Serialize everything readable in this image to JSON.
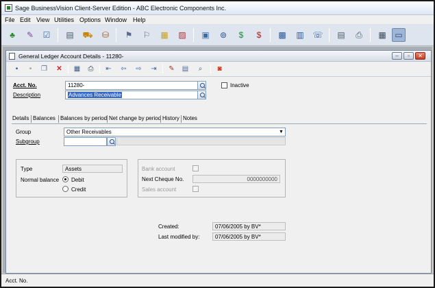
{
  "app": {
    "title": "Sage BusinessVision Client-Server Edition - ABC Electronic Components Inc."
  },
  "menu": [
    "File",
    "Edit",
    "View",
    "Utilities",
    "Options",
    "Window",
    "Help"
  ],
  "toolbar": {
    "icons": [
      "sales-order-icon",
      "purchase-order-icon",
      "checklist-icon",
      "printer-register-icon",
      "truck-icon",
      "cart-icon",
      "inventory-icon",
      "stamp-icon",
      "report-icon",
      "graph-icon",
      "calendar-icon",
      "find-icon",
      "dollar-green-icon",
      "dollar-red-icon",
      "customer-card-icon",
      "calculator-pad-icon",
      "phone-list-icon",
      "ledger-icon",
      "print-icon",
      "calculator-icon",
      "window-icon"
    ],
    "colors": {
      "background": "#dfe5ee",
      "active": "#9fb6d6"
    }
  },
  "window": {
    "title": "General Ledger Account Details - 11280-",
    "toolbar_icons": [
      "new-icon",
      "save-icon",
      "copy-icon",
      "delete-icon",
      "grid-icon",
      "print-icon",
      "first-record-icon",
      "previous-record-icon",
      "next-record-icon",
      "last-record-icon",
      "edit-icon",
      "attach-icon",
      "zoom-icon",
      "stop-icon"
    ]
  },
  "form": {
    "acct_no_label": "Acct. No.",
    "acct_no_value": "11280-",
    "description_label": "Description",
    "description_value": "Advances Receivable",
    "inactive_label": "Inactive"
  },
  "tabs": [
    "Details",
    "Balances",
    "Balances by period",
    "Net change by period",
    "History",
    "Notes"
  ],
  "details": {
    "group_label": "Group",
    "group_value": "Other Receivables",
    "subgroup_label": "Subgroup",
    "subgroup_value": "",
    "type_label": "Type",
    "type_value": "Assets",
    "normal_balance_label": "Normal balance",
    "debit_label": "Debit",
    "credit_label": "Credit",
    "normal_balance_selected": "Debit",
    "bank_account_label": "Bank account",
    "next_cheque_label": "Next Cheque No.",
    "next_cheque_value": "0000000000",
    "sales_account_label": "Sales account",
    "created_label": "Created:",
    "created_value": "07/06/2005 by BV*",
    "modified_label": "Last modified by:",
    "modified_value": "07/06/2005 by BV*"
  },
  "status": {
    "text": "Acct. No."
  }
}
